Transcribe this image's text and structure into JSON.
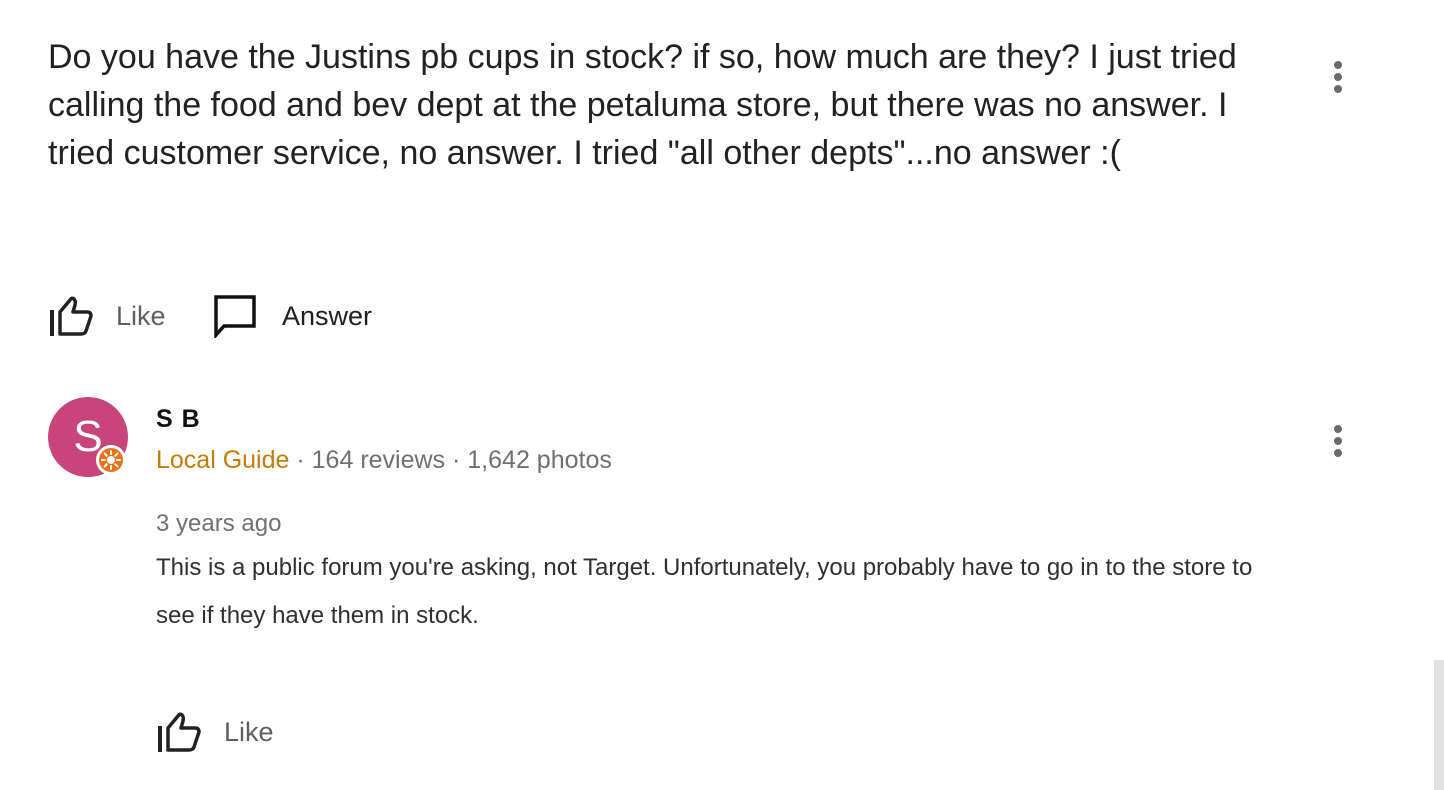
{
  "question": {
    "text": "Do you have the Justins pb cups in stock? if so, how much are they? I just tried calling the food and bev dept at the petaluma store, but there was no answer. I tried customer service, no answer. I tried \"all other depts\"...no answer :(",
    "like_label": "Like",
    "answer_label": "Answer",
    "more_icon": "more-vert-icon"
  },
  "answer": {
    "avatar_letter": "S",
    "avatar_color": "#c8457c",
    "author_name": "S B",
    "local_guide_label": "Local Guide",
    "separator": " · ",
    "reviews": "164 reviews",
    "photos": "1,642 photos",
    "timestamp": "3 years ago",
    "text": "This is a public forum you're asking, not Target. Unfortunately, you probably have to go in to the store to see if they have them in stock.",
    "like_label": "Like",
    "more_icon": "more-vert-icon"
  },
  "colors": {
    "local_guide": "#c77a05",
    "meta_text": "#707070",
    "badge": "#e8711a"
  }
}
